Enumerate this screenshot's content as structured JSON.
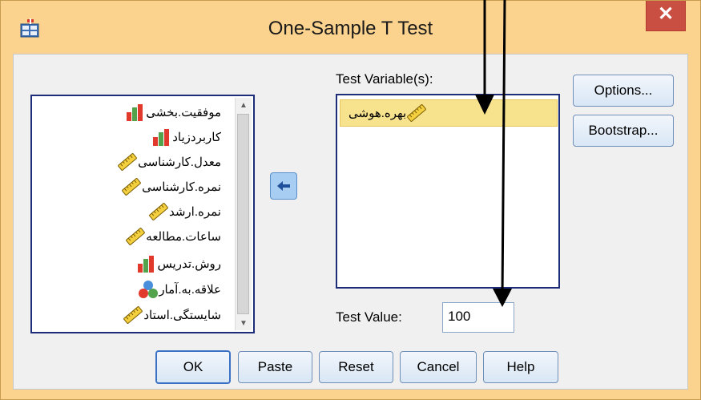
{
  "window": {
    "title": "One-Sample T Test",
    "close_glyph": "✕"
  },
  "source_variables": [
    {
      "label": "موفقیت.بخشی",
      "icon": "nominal-bar-icon"
    },
    {
      "label": "کاربردزیاد",
      "icon": "nominal-bar-icon"
    },
    {
      "label": "معدل.کارشناسی",
      "icon": "scale-ruler-icon"
    },
    {
      "label": "نمره.کارشناسی",
      "icon": "scale-ruler-icon"
    },
    {
      "label": "نمره.ارشد",
      "icon": "scale-ruler-icon"
    },
    {
      "label": "ساعات.مطالعه",
      "icon": "scale-ruler-icon"
    },
    {
      "label": "روش.تدریس",
      "icon": "nominal-bar-icon"
    },
    {
      "label": "علاقه.به.آمار",
      "icon": "ordinal-circles-icon"
    },
    {
      "label": "شایستگی.استاد",
      "icon": "scale-ruler-icon"
    }
  ],
  "test_variables": {
    "label": "Test Variable(s):",
    "items": [
      {
        "label": "بهره.هوشی",
        "icon": "scale-ruler-icon"
      }
    ]
  },
  "test_value": {
    "label": "Test Value:",
    "value": "100"
  },
  "side_buttons": {
    "options": "Options...",
    "bootstrap": "Bootstrap..."
  },
  "footer_buttons": {
    "ok": "OK",
    "paste": "Paste",
    "reset": "Reset",
    "cancel": "Cancel",
    "help": "Help"
  },
  "colors": {
    "title_bar": "#fbd38e",
    "close": "#c94f43",
    "selection": "#f7e28d",
    "list_border": "#1e2d7a"
  }
}
